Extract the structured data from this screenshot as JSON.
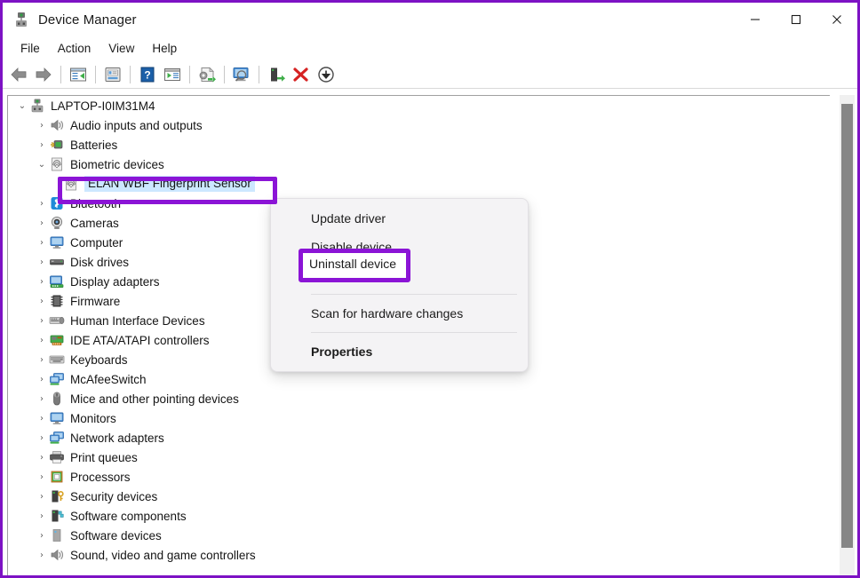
{
  "window": {
    "title": "Device Manager",
    "app_icon": "device-manager-icon",
    "controls": {
      "minimize": "—",
      "maximize": "□",
      "close": "✕"
    }
  },
  "menubar": {
    "items": [
      {
        "label": "File",
        "name": "menu-file"
      },
      {
        "label": "Action",
        "name": "menu-action"
      },
      {
        "label": "View",
        "name": "menu-view"
      },
      {
        "label": "Help",
        "name": "menu-help"
      }
    ]
  },
  "toolbar": {
    "buttons": [
      {
        "name": "back-icon",
        "title": "Back"
      },
      {
        "name": "forward-icon",
        "title": "Forward"
      },
      {
        "name": "separator",
        "title": ""
      },
      {
        "name": "show-hide-console-tree-icon",
        "title": "Show/Hide Console Tree"
      },
      {
        "name": "separator",
        "title": ""
      },
      {
        "name": "properties-icon",
        "title": "Properties"
      },
      {
        "name": "separator",
        "title": ""
      },
      {
        "name": "help-icon",
        "title": "Help"
      },
      {
        "name": "show-hide-action-pane-icon",
        "title": "Show/Hide Action Pane"
      },
      {
        "name": "separator",
        "title": ""
      },
      {
        "name": "update-driver-icon",
        "title": "Update Driver Software"
      },
      {
        "name": "separator",
        "title": ""
      },
      {
        "name": "scan-hardware-changes-icon",
        "title": "Scan for hardware changes"
      },
      {
        "name": "separator",
        "title": ""
      },
      {
        "name": "enable-device-icon",
        "title": "Enable device"
      },
      {
        "name": "uninstall-device-icon",
        "title": "Uninstall device"
      },
      {
        "name": "disable-device-icon",
        "title": "Disable device"
      }
    ]
  },
  "tree": {
    "root": {
      "label": "LAPTOP-I0IM31M4",
      "icon": "computer-root-icon",
      "expanded": true
    },
    "nodes": [
      {
        "label": "Audio inputs and outputs",
        "icon": "speaker-icon",
        "expander": "›",
        "indent": 1,
        "selected": false
      },
      {
        "label": "Batteries",
        "icon": "battery-icon",
        "expander": "›",
        "indent": 1,
        "selected": false
      },
      {
        "label": "Biometric devices",
        "icon": "fingerprint-icon",
        "expander": "⌄",
        "indent": 1,
        "selected": false
      },
      {
        "label": "ELAN WBF Fingerprint Sensor",
        "icon": "fingerprint-device-icon",
        "expander": "",
        "indent": 2,
        "selected": true
      },
      {
        "label": "Bluetooth",
        "icon": "bluetooth-icon",
        "expander": "›",
        "indent": 1,
        "selected": false
      },
      {
        "label": "Cameras",
        "icon": "camera-icon",
        "expander": "›",
        "indent": 1,
        "selected": false
      },
      {
        "label": "Computer",
        "icon": "monitor-icon",
        "expander": "›",
        "indent": 1,
        "selected": false
      },
      {
        "label": "Disk drives",
        "icon": "disk-drive-icon",
        "expander": "›",
        "indent": 1,
        "selected": false
      },
      {
        "label": "Display adapters",
        "icon": "display-adapter-icon",
        "expander": "›",
        "indent": 1,
        "selected": false
      },
      {
        "label": "Firmware",
        "icon": "firmware-chip-icon",
        "expander": "›",
        "indent": 1,
        "selected": false
      },
      {
        "label": "Human Interface Devices",
        "icon": "hid-icon",
        "expander": "›",
        "indent": 1,
        "selected": false
      },
      {
        "label": "IDE ATA/ATAPI controllers",
        "icon": "ide-controller-icon",
        "expander": "›",
        "indent": 1,
        "selected": false
      },
      {
        "label": "Keyboards",
        "icon": "keyboard-icon",
        "expander": "›",
        "indent": 1,
        "selected": false
      },
      {
        "label": "McAfeeSwitch",
        "icon": "network-switch-icon",
        "expander": "›",
        "indent": 1,
        "selected": false
      },
      {
        "label": "Mice and other pointing devices",
        "icon": "mouse-icon",
        "expander": "›",
        "indent": 1,
        "selected": false
      },
      {
        "label": "Monitors",
        "icon": "monitor-icon",
        "expander": "›",
        "indent": 1,
        "selected": false
      },
      {
        "label": "Network adapters",
        "icon": "network-adapter-icon",
        "expander": "›",
        "indent": 1,
        "selected": false
      },
      {
        "label": "Print queues",
        "icon": "printer-icon",
        "expander": "›",
        "indent": 1,
        "selected": false
      },
      {
        "label": "Processors",
        "icon": "processor-icon",
        "expander": "›",
        "indent": 1,
        "selected": false
      },
      {
        "label": "Security devices",
        "icon": "security-key-icon",
        "expander": "›",
        "indent": 1,
        "selected": false
      },
      {
        "label": "Software components",
        "icon": "software-component-icon",
        "expander": "›",
        "indent": 1,
        "selected": false
      },
      {
        "label": "Software devices",
        "icon": "software-device-icon",
        "expander": "›",
        "indent": 1,
        "selected": false
      },
      {
        "label": "Sound, video and game controllers",
        "icon": "speaker-icon",
        "expander": "›",
        "indent": 1,
        "selected": false
      }
    ]
  },
  "context_menu": {
    "items": [
      {
        "label": "Update driver",
        "type": "item",
        "bold": false,
        "name": "ctx-update-driver"
      },
      {
        "label": "Disable device",
        "type": "item",
        "bold": false,
        "name": "ctx-disable-device"
      },
      {
        "label": "Uninstall device",
        "type": "item",
        "bold": false,
        "name": "ctx-uninstall-device",
        "highlighted": true
      },
      {
        "label": "",
        "type": "separator",
        "bold": false,
        "name": "ctx-separator-1"
      },
      {
        "label": "Scan for hardware changes",
        "type": "item",
        "bold": false,
        "name": "ctx-scan-hardware-changes"
      },
      {
        "label": "",
        "type": "separator",
        "bold": false,
        "name": "ctx-separator-2"
      },
      {
        "label": "Properties",
        "type": "item",
        "bold": true,
        "name": "ctx-properties"
      }
    ]
  },
  "annotations": {
    "color": "#8b14d6",
    "boxes": [
      {
        "name": "annotation-selected-device",
        "target": "ELAN WBF Fingerprint Sensor"
      },
      {
        "name": "annotation-uninstall-device",
        "target": "Uninstall device"
      }
    ],
    "uninstall_label": "Uninstall device"
  },
  "scrollbar": {
    "orientation": "vertical",
    "name": "vertical-scrollbar"
  }
}
